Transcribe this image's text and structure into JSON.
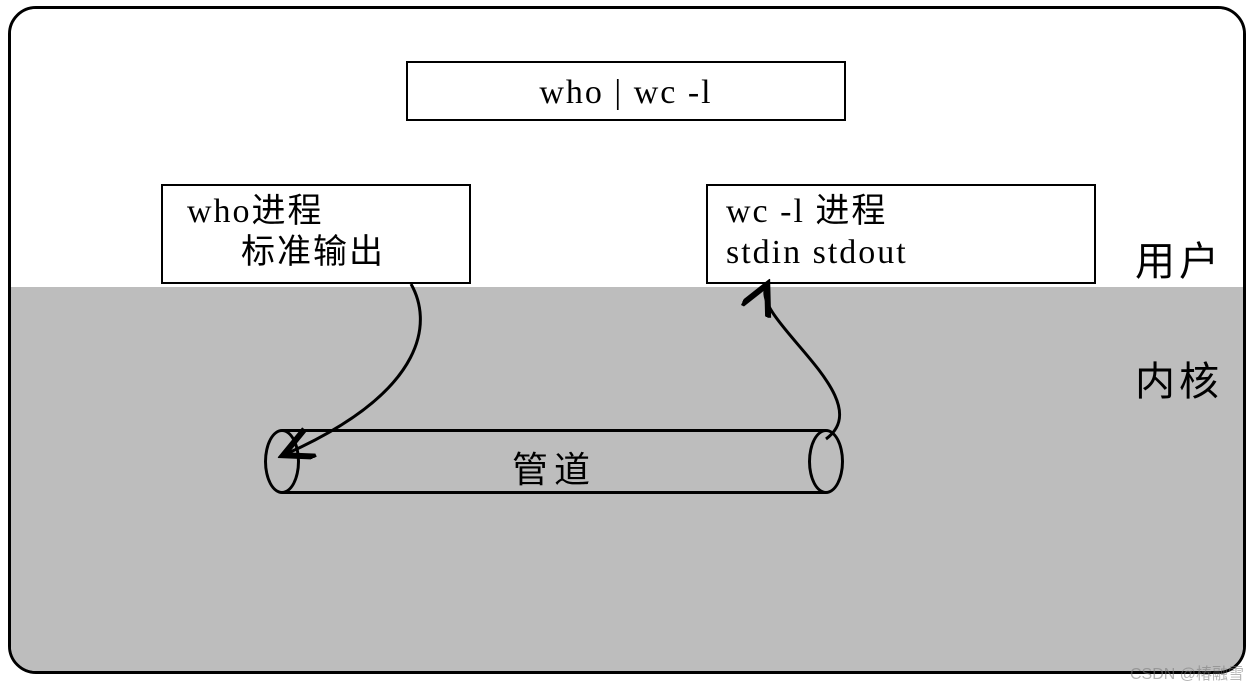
{
  "command": "who | wc -l",
  "who_box": {
    "line1": "who进程",
    "line2": "标准输出"
  },
  "wc_box": {
    "line1": " wc -l 进程",
    "line2": "stdin   stdout"
  },
  "pipe_label": "管道",
  "labels": {
    "user": "用户",
    "kernel": "内核"
  },
  "watermark": "CSDN @椿融雪"
}
